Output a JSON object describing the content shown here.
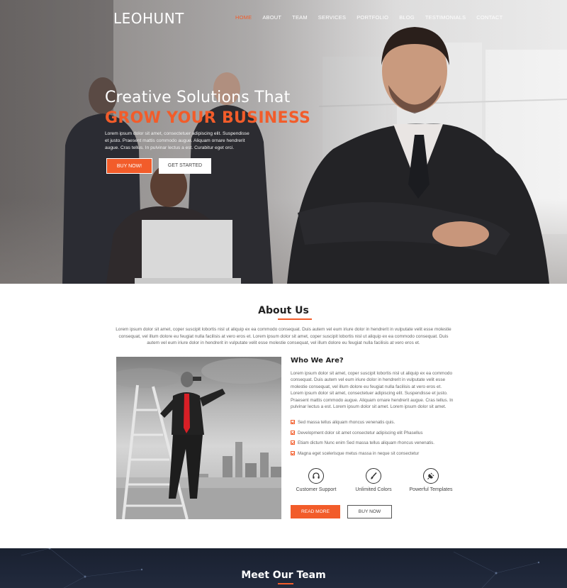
{
  "brand": {
    "logo": "LEOHUNT",
    "accent": "#f25c2a"
  },
  "nav": {
    "items": [
      {
        "label": "HOME",
        "active": true
      },
      {
        "label": "ABOUT"
      },
      {
        "label": "TEAM"
      },
      {
        "label": "SERVICES"
      },
      {
        "label": "PORTFOLIO"
      },
      {
        "label": "BLOG"
      },
      {
        "label": "TESTIMONIALS"
      },
      {
        "label": "CONTACT"
      }
    ]
  },
  "hero": {
    "title": "Creative Solutions That",
    "highlight": "GROW YOUR BUSINESS",
    "text": "Lorem ipsum dolor sit amet, consectetuer adipiscing elit. Suspendisse et justo. Praesent mattis commodo augue. Aliquam ornare hendrerit augue. Cras tellus. In pulvinar lectus a est. Curabitur eget orci.",
    "buy_label": "BUY NOW!",
    "start_label": "GET STARTED"
  },
  "about": {
    "title": "About Us",
    "text": "Lorem ipsum dolor sit amet, coper suscipit lobortis nisl ut aliquip ex ea commodo consequat. Duis autem vel eum iriure dolor in hendrerit in vulputate velit esse molestie consequat, vel illum dolore eu feugiat nulla facilisis at vero eros et. Lorem ipsum dolor sit amet, coper suscipit lobortis nisl ut aliquip ex ea commodo consequat. Duis autem vel eum iriure dolor in hendrerit in vulputate velit esse molestie consequat, vel illum dolore eu feugiat nulla facilisis at vero eros et.",
    "who_title": "Who We Are?",
    "who_text": "Lorem ipsum dolor sit amet, coper suscipit lobortis nisl ut aliquip ex ea commodo consequat. Duis autem vel eum iriure dolor in hendrerit in vulputate velit esse molestie consequat, vel illum dolore eu feugiat nulla facilisis at vero eros et. Lorem ipsum dolor sit amet, consectetuer adipiscing elit. Suspendisse et justo. Praesent mattis commodo augue. Aliquam ornare hendrerit augue. Cras tellus. In pulvinar lectus a est. Lorem ipsum dolor sit amet. Lorem ipsum dolor sit amet.",
    "checklist": [
      "Sed massa tellus aliquam rhoncus venenatis quis.",
      "Development dolor sit amet consectetur adipiscing elit Phasellus",
      "Etiam dictum Nunc enim Sed massa tellus aliquam rhoncus venenatis.",
      "Magna eget scelerisque metus massa in neque sit consectetur"
    ],
    "features": [
      {
        "label": "Customer Support",
        "icon": "headset-icon"
      },
      {
        "label": "Unlimited Colors",
        "icon": "brush-icon"
      },
      {
        "label": "Powerful Templates",
        "icon": "plug-icon"
      }
    ],
    "read_label": "READ MORE",
    "buy_label": "BUY NOW"
  },
  "team": {
    "title": "Meet Our Team"
  }
}
